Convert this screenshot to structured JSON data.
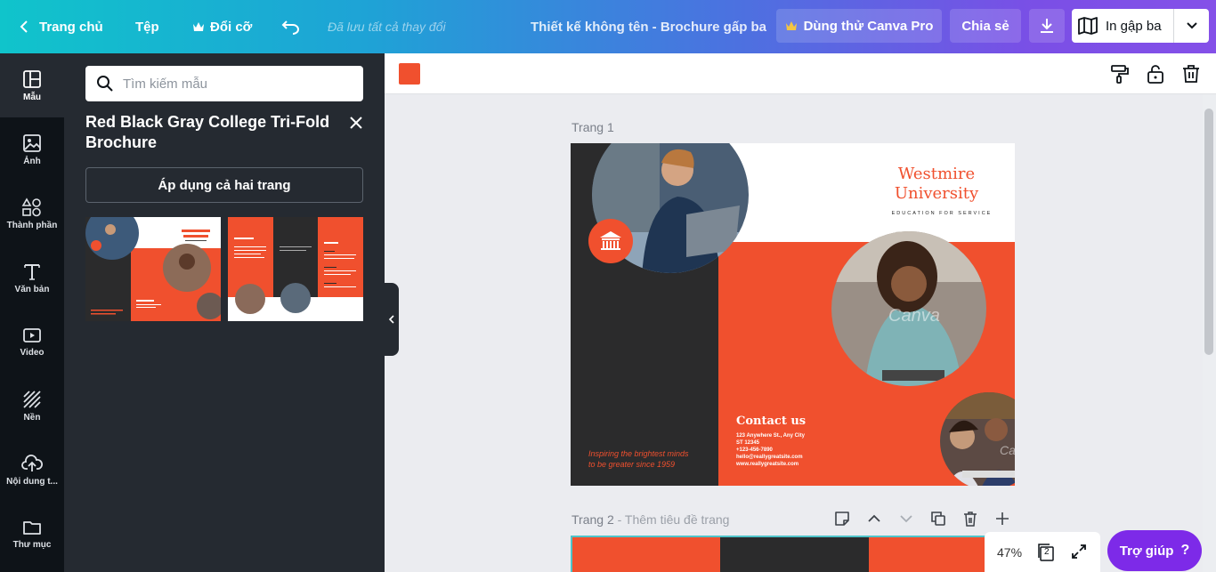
{
  "topbar": {
    "back_label": "Trang chủ",
    "file_label": "Tệp",
    "resize_label": "Đổi cỡ",
    "saved_text": "Đã lưu tất cả thay đổi",
    "doc_title": "Thiết kế không tên - Brochure gấp ba",
    "pro_label": "Dùng thử Canva Pro",
    "share_label": "Chia sẻ",
    "print_label": "In gập ba"
  },
  "rail": {
    "items": [
      {
        "label": "Mẫu",
        "icon": "template-icon"
      },
      {
        "label": "Ảnh",
        "icon": "photo-icon"
      },
      {
        "label": "Thành phần",
        "icon": "elements-icon"
      },
      {
        "label": "Văn bản",
        "icon": "text-icon"
      },
      {
        "label": "Video",
        "icon": "video-icon"
      },
      {
        "label": "Nền",
        "icon": "background-icon"
      },
      {
        "label": "Nội dung t...",
        "icon": "upload-icon"
      },
      {
        "label": "Thư mục",
        "icon": "folder-icon"
      }
    ]
  },
  "panel": {
    "search_placeholder": "Tìm kiếm mẫu",
    "template_title": "Red Black Gray College Tri-Fold Brochure",
    "apply_label": "Áp dụng cả hai trang",
    "thumb1": {
      "title": "Westmire University",
      "contact": "Contact us",
      "tagline": "Inspiring the brightest minds"
    },
    "thumb2": {
      "enrollment": "Enrollment",
      "about": "About us"
    }
  },
  "colors": {
    "accent": "#f0502e",
    "dark": "#2b2b2c",
    "help": "#7d2ae8"
  },
  "canvas": {
    "page1_label": "Trang 1",
    "page2_label": "Trang 2",
    "page2_sub": " - Thêm tiêu đề trang",
    "zoom": "47%",
    "page_count": "2",
    "help_label": "Trợ giúp"
  },
  "brochure": {
    "title_line1": "Westmire",
    "title_line2": "University",
    "subtitle": "EDUCATION FOR SERVICE",
    "tagline_line1": "Inspiring the brightest minds",
    "tagline_line2": "to be greater since 1959",
    "contact_title": "Contact us",
    "contact_lines": [
      "123 Anywhere St., Any City",
      "ST 12345",
      "+123-456-7890",
      "hello@reallygreatsite.com",
      "www.reallygreatsite.com"
    ],
    "watermark": "Canva"
  }
}
